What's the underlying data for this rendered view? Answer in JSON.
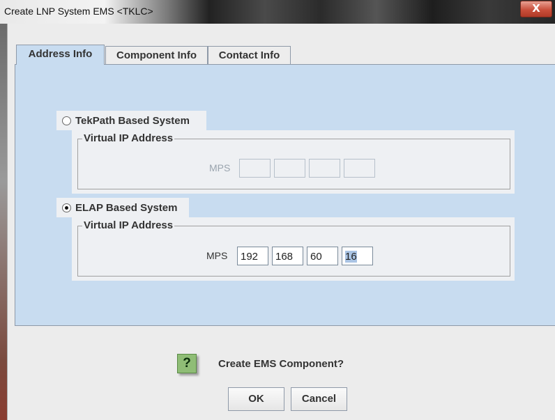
{
  "window": {
    "title": "Create LNP System EMS <TKLC>",
    "close_glyph": "X"
  },
  "tabs": [
    {
      "label": "Address Info",
      "active": true
    },
    {
      "label": "Component Info",
      "active": false
    },
    {
      "label": "Contact Info",
      "active": false
    }
  ],
  "tekpath": {
    "label": "TekPath Based System",
    "selected": false,
    "group_title": "Virtual IP Address",
    "mps_label": "MPS",
    "octets": [
      "",
      "",
      "",
      ""
    ]
  },
  "elap": {
    "label": "ELAP Based System",
    "selected": true,
    "group_title": "Virtual IP Address",
    "mps_label": "MPS",
    "octets": [
      "192",
      "168",
      "60",
      "16"
    ]
  },
  "confirm": {
    "icon": "question-icon",
    "icon_glyph": "?",
    "message": "Create EMS Component?",
    "ok_label": "OK",
    "cancel_label": "Cancel"
  }
}
